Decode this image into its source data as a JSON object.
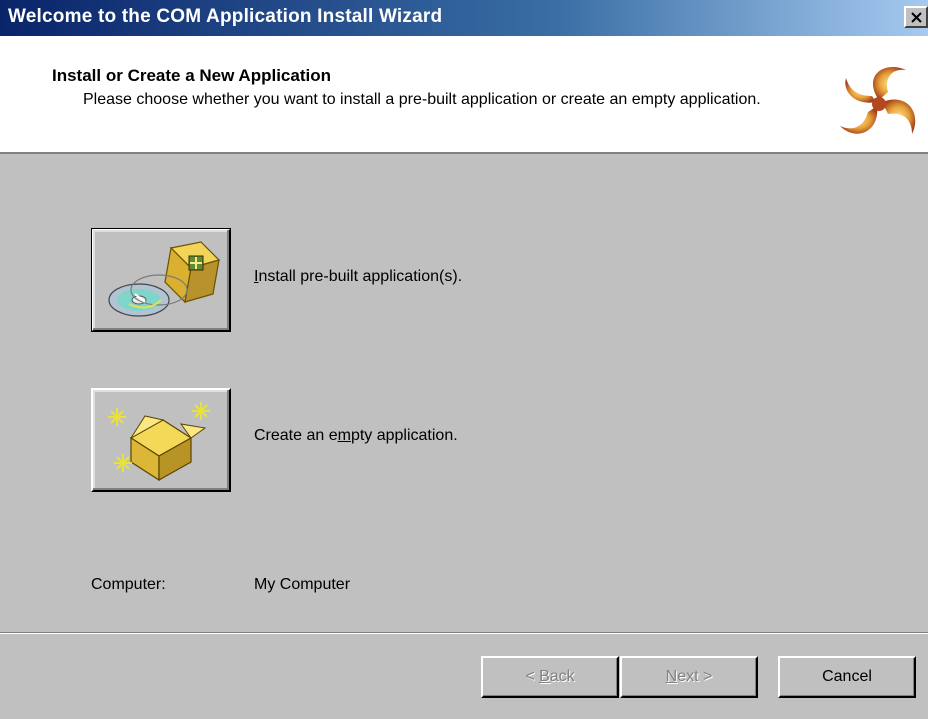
{
  "window": {
    "title": "Welcome to the COM Application Install Wizard"
  },
  "header": {
    "title": "Install or Create a New Application",
    "subtitle": "Please choose whether you want to install a pre-built application or create an empty application.",
    "logo_icon": "com-plus-swirl-icon"
  },
  "options": {
    "install": {
      "label_before": "",
      "label_accel": "I",
      "label_after": "nstall pre-built application(s).",
      "icon": "cd-and-package-icon"
    },
    "empty": {
      "label_before": "Create an e",
      "label_accel": "m",
      "label_after": "pty application.",
      "icon": "open-box-sparkle-icon"
    }
  },
  "computer": {
    "label": "Computer:",
    "value": "My Computer"
  },
  "buttons": {
    "back": {
      "prefix": "< ",
      "accel": "B",
      "rest": "ack"
    },
    "next": {
      "accel": "N",
      "rest": "ext >"
    },
    "cancel": "Cancel"
  },
  "colors": {
    "titlebar_start": "#0a246a",
    "titlebar_end": "#a6caf0",
    "dialog_face": "#c0c0c0",
    "header_bg": "#ffffff"
  }
}
